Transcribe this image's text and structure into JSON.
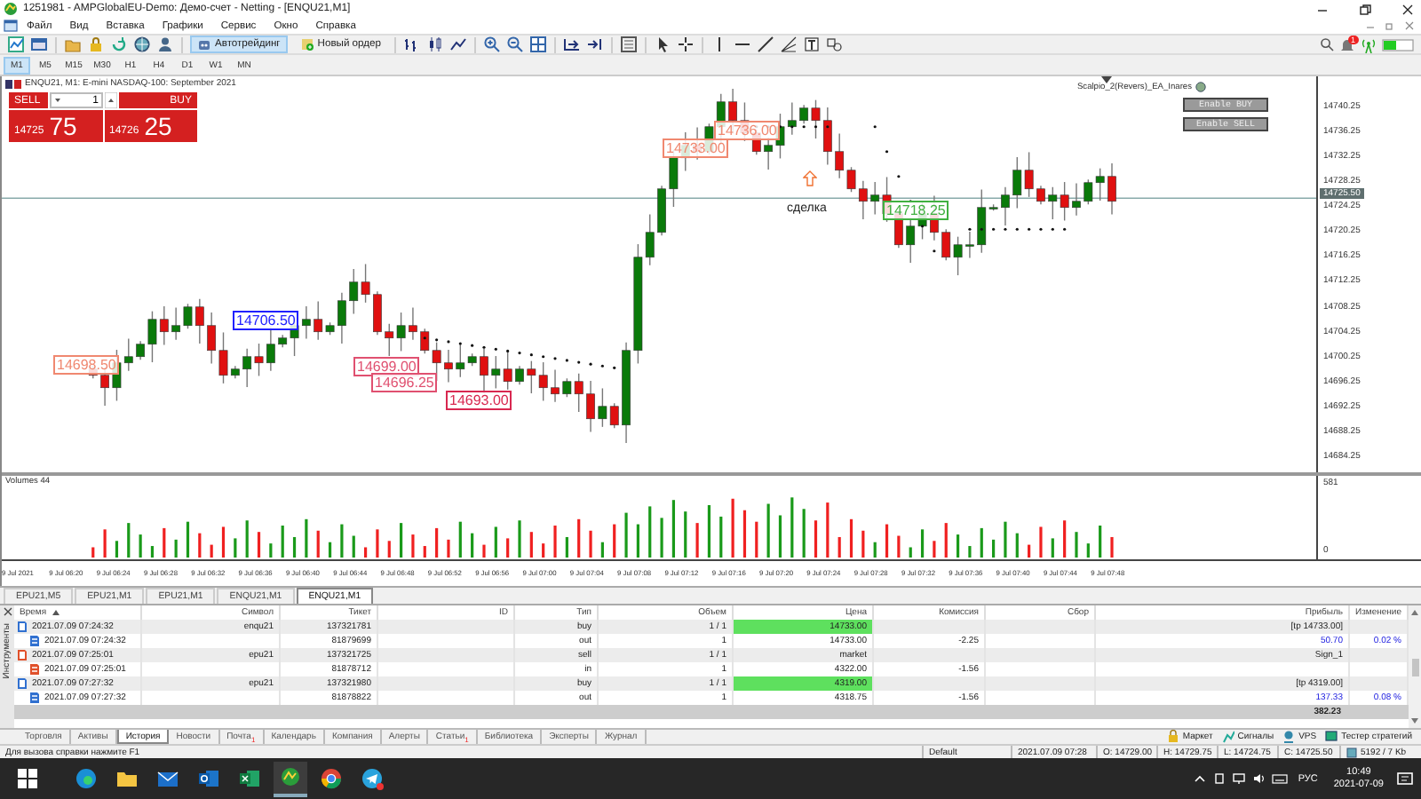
{
  "window": {
    "title": "1251981 - AMPGlobalEU-Demo: Демо-счет - Netting - [ENQU21,M1]"
  },
  "menu": [
    "Файл",
    "Вид",
    "Вставка",
    "Графики",
    "Сервис",
    "Окно",
    "Справка"
  ],
  "toolbar": {
    "buttons": [
      {
        "label": "Автотрейдинг",
        "selected": true
      },
      {
        "label": "Новый ордер",
        "selected": false
      }
    ],
    "notification_count": "1"
  },
  "timeframes": [
    {
      "label": "M1",
      "selected": true
    },
    {
      "label": "M5",
      "selected": false
    },
    {
      "label": "M15",
      "selected": false
    },
    {
      "label": "M30",
      "selected": false
    },
    {
      "label": "H1",
      "selected": false
    },
    {
      "label": "H4",
      "selected": false
    },
    {
      "label": "D1",
      "selected": false
    },
    {
      "label": "W1",
      "selected": false
    },
    {
      "label": "MN",
      "selected": false
    }
  ],
  "chart": {
    "header": "ENQU21, M1:  E-mini NASDAQ-100: September 2021",
    "trade_panel": {
      "sell_label": "SELL",
      "buy_label": "BUY",
      "volume": "1",
      "sell_price": "14725",
      "sell_pips": "75",
      "buy_price": "14726",
      "buy_pips": "25"
    },
    "expert_name": "Scalpio_2(Revers)_EA_Inares",
    "expert_buttons": [
      "Enable BUY",
      "Enable SELL"
    ],
    "price_labels": [
      {
        "text": "14698.50",
        "color": "#f08870"
      },
      {
        "text": "14706.50",
        "color": "#2020ff"
      },
      {
        "text": "14699.00",
        "color": "#e05070"
      },
      {
        "text": "14696.25",
        "color": "#e05070"
      },
      {
        "text": "14693.00",
        "color": "#d82850"
      },
      {
        "text": "14736.00",
        "color": "#f08870"
      },
      {
        "text": "14733.00",
        "color": "#f08870"
      },
      {
        "text": "14718.25",
        "color": "#40b040"
      }
    ],
    "annotation": "сделка",
    "price_axis": [
      "14740.25",
      "14736.25",
      "14732.25",
      "14728.25",
      "14724.25",
      "14720.25",
      "14716.25",
      "14712.25",
      "14708.25",
      "14704.25",
      "14700.25",
      "14696.25",
      "14692.25",
      "14688.25",
      "14684.25"
    ],
    "current_price": "14725.50",
    "volume_label": "Volumes 44",
    "volume_axis": [
      "581",
      "0"
    ],
    "time_axis": [
      "9 Jul 2021",
      "9 Jul 06:20",
      "9 Jul 06:24",
      "9 Jul 06:28",
      "9 Jul 06:32",
      "9 Jul 06:36",
      "9 Jul 06:40",
      "9 Jul 06:44",
      "9 Jul 06:48",
      "9 Jul 06:52",
      "9 Jul 06:56",
      "9 Jul 07:00",
      "9 Jul 07:04",
      "9 Jul 07:08",
      "9 Jul 07:12",
      "9 Jul 07:16",
      "9 Jul 07:20",
      "9 Jul 07:24",
      "9 Jul 07:28",
      "9 Jul 07:32",
      "9 Jul 07:36",
      "9 Jul 07:40",
      "9 Jul 07:44",
      "9 Jul 07:48"
    ]
  },
  "chart_tabs": [
    {
      "label": "EPU21,M5",
      "selected": false
    },
    {
      "label": "EPU21,M1",
      "selected": false
    },
    {
      "label": "EPU21,M1",
      "selected": false
    },
    {
      "label": "ENQU21,M1",
      "selected": false
    },
    {
      "label": "ENQU21,M1",
      "selected": true
    }
  ],
  "history": {
    "title": "Инструменты",
    "columns": [
      "Время",
      "Символ",
      "Тикет",
      "ID",
      "Тип",
      "Объем",
      "Цена",
      "Комиссия",
      "Сбор",
      "Прибыль",
      "Изменение"
    ],
    "rows": [
      {
        "kind": "order",
        "color": "#3070d0",
        "time": "2021.07.09 07:24:32",
        "symbol": "enqu21",
        "ticket": "137321781",
        "type": "buy",
        "volume": "1 / 1",
        "price": "14733.00",
        "price_highlight": true,
        "profit": "[tp 14733.00]"
      },
      {
        "kind": "deal",
        "color": "#3070d0",
        "time": "2021.07.09 07:24:32",
        "ticket": "81879699",
        "type": "out",
        "volume": "1",
        "price": "14733.00",
        "price_highlight": false,
        "commission": "-2.25",
        "profit": "50.70",
        "change": "0.02 %"
      },
      {
        "kind": "order",
        "color": "#e0502a",
        "time": "2021.07.09 07:25:01",
        "symbol": "epu21",
        "ticket": "137321725",
        "type": "sell",
        "volume": "1 / 1",
        "price": "market",
        "price_highlight": false,
        "profit": "Sign_1"
      },
      {
        "kind": "deal",
        "color": "#e0502a",
        "time": "2021.07.09 07:25:01",
        "ticket": "81878712",
        "type": "in",
        "volume": "1",
        "price": "4322.00",
        "price_highlight": false,
        "commission": "-1.56"
      },
      {
        "kind": "order",
        "color": "#3070d0",
        "time": "2021.07.09 07:27:32",
        "symbol": "epu21",
        "ticket": "137321980",
        "type": "buy",
        "volume": "1 / 1",
        "price": "4319.00",
        "price_highlight": true,
        "profit": "[tp 4319.00]"
      },
      {
        "kind": "deal",
        "color": "#3070d0",
        "time": "2021.07.09 07:27:32",
        "ticket": "81878822",
        "type": "out",
        "volume": "1",
        "price": "4318.75",
        "price_highlight": false,
        "commission": "-1.56",
        "profit": "137.33",
        "change": "0.08 %"
      }
    ],
    "total": "382.23"
  },
  "toolbox_tabs": [
    {
      "label": "Торговля",
      "selected": false
    },
    {
      "label": "Активы",
      "selected": false
    },
    {
      "label": "История",
      "selected": true
    },
    {
      "label": "Новости",
      "selected": false
    },
    {
      "label": "Почта",
      "badge": "1",
      "selected": false
    },
    {
      "label": "Календарь",
      "selected": false
    },
    {
      "label": "Компания",
      "selected": false
    },
    {
      "label": "Алерты",
      "selected": false
    },
    {
      "label": "Статьи",
      "badge": "1",
      "selected": false
    },
    {
      "label": "Библиотека",
      "selected": false
    },
    {
      "label": "Эксперты",
      "selected": false
    },
    {
      "label": "Журнал",
      "selected": false
    }
  ],
  "services": [
    "Маркет",
    "Сигналы",
    "VPS",
    "Тестер стратегий"
  ],
  "status_bar": {
    "help": "Для вызова справки нажмите F1",
    "profile": "Default",
    "time": "2021.07.09 07:28",
    "open": "O: 14729.00",
    "high": "H: 14729.75",
    "low": "L: 14724.75",
    "close": "C: 14725.50",
    "traffic": "5192 / 7 Kb"
  },
  "taskbar": {
    "language": "РУС",
    "time": "10:49",
    "date": "2021-07-09"
  }
}
